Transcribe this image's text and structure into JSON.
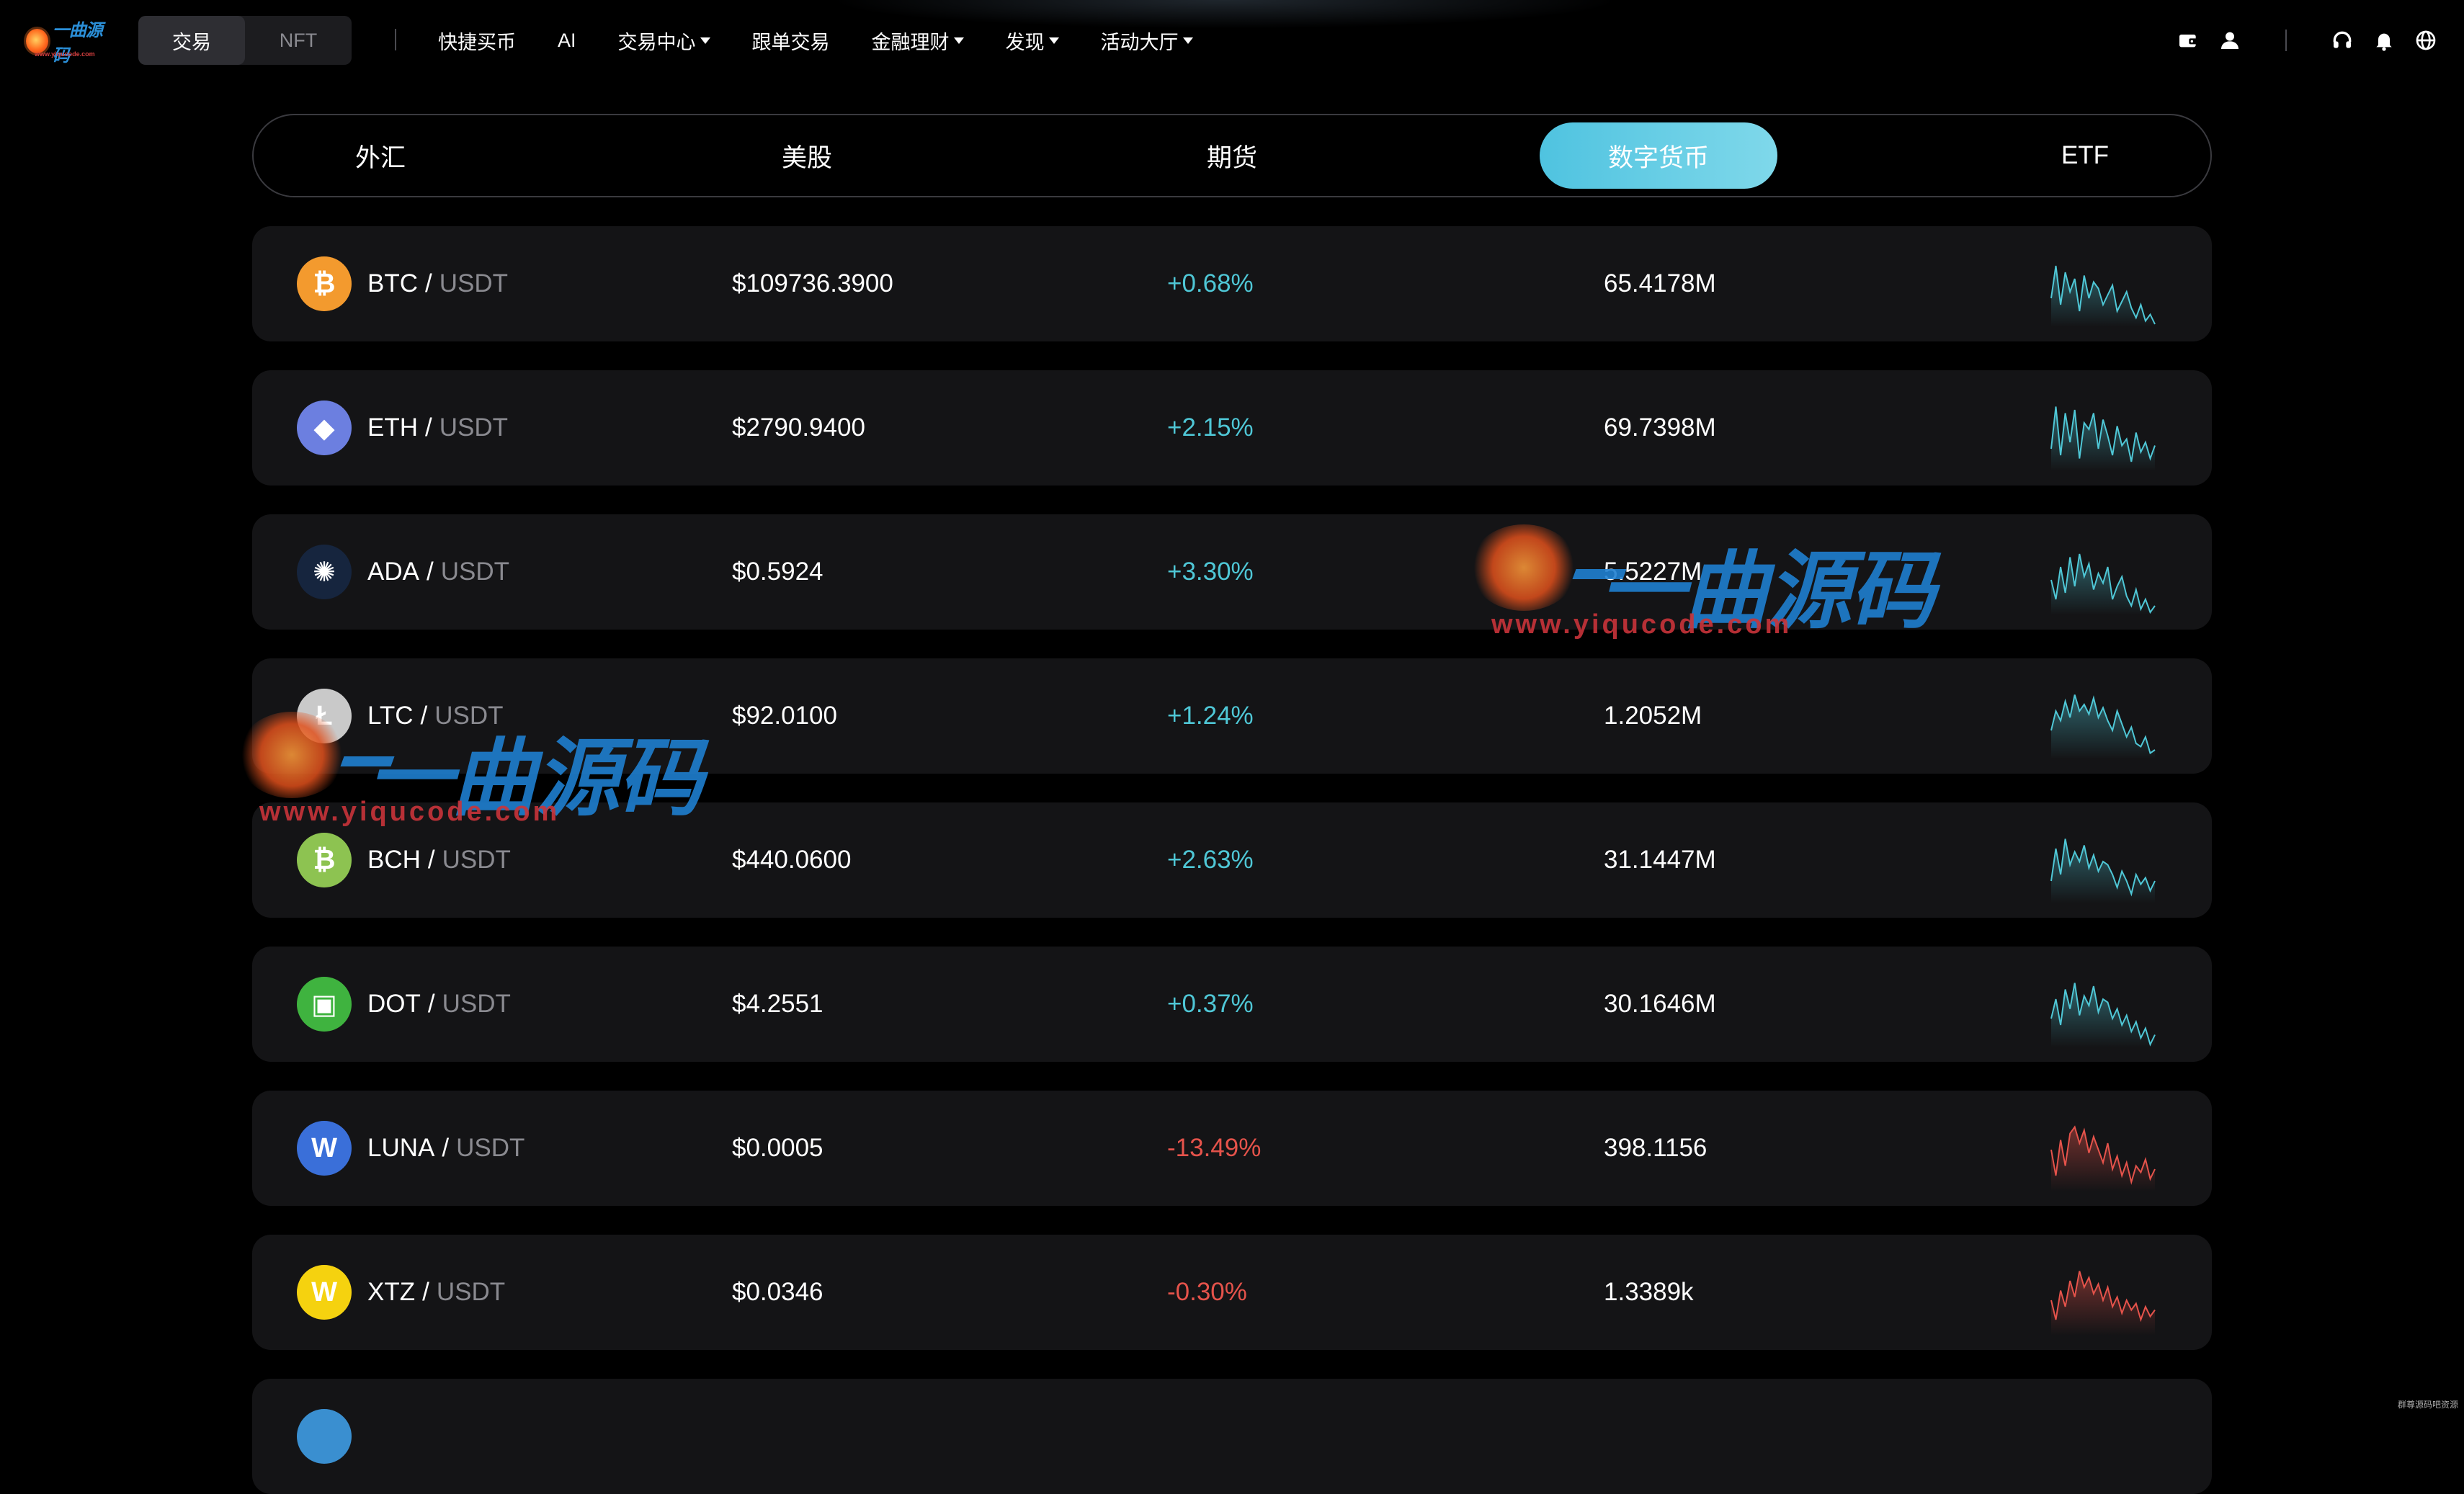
{
  "logo": {
    "text": "一曲源码",
    "url": "www.yiqucode.com"
  },
  "mode_switch": [
    {
      "label": "交易",
      "active": true
    },
    {
      "label": "NFT",
      "active": false
    }
  ],
  "nav": {
    "links": [
      {
        "label": "快捷买币",
        "dropdown": false
      },
      {
        "label": "AI",
        "dropdown": false
      },
      {
        "label": "交易中心",
        "dropdown": true
      },
      {
        "label": "跟单交易",
        "dropdown": false
      },
      {
        "label": "金融理财",
        "dropdown": true
      },
      {
        "label": "发现",
        "dropdown": true
      },
      {
        "label": "活动大厅",
        "dropdown": true
      }
    ],
    "right_icons": [
      "wallet-icon",
      "user-icon",
      "headset-icon",
      "bell-icon",
      "globe-icon"
    ]
  },
  "category_tabs": [
    {
      "label": "外汇",
      "active": false
    },
    {
      "label": "美股",
      "active": false
    },
    {
      "label": "期货",
      "active": false
    },
    {
      "label": "数字货币",
      "active": true
    },
    {
      "label": "ETF",
      "active": false
    }
  ],
  "colors": {
    "up": "#4fc7d6",
    "down": "#e5534b",
    "accent": "#5ccbe4",
    "row_bg": "#141416"
  },
  "markets": [
    {
      "base": "BTC",
      "quote": "USDT",
      "price": "$109736.3900",
      "change": "+0.68%",
      "direction": "up",
      "volume": "65.4178M",
      "icon": "bitcoin-icon",
      "icon_color": "#f39a2e",
      "icon_glyph": "₿",
      "spark": [
        40,
        90,
        30,
        80,
        50,
        70,
        20,
        75,
        40,
        65,
        55,
        30,
        45,
        60,
        20,
        35,
        50,
        25,
        10,
        30,
        5,
        15,
        0
      ]
    },
    {
      "base": "ETH",
      "quote": "USDT",
      "price": "$2790.9400",
      "change": "+2.15%",
      "direction": "up",
      "volume": "69.7398M",
      "icon": "ethereum-icon",
      "icon_color": "#6c7fe0",
      "icon_glyph": "◆",
      "spark": [
        30,
        95,
        20,
        85,
        40,
        90,
        15,
        70,
        60,
        85,
        30,
        75,
        50,
        20,
        65,
        35,
        45,
        10,
        55,
        25,
        40,
        15,
        35
      ]
    },
    {
      "base": "ADA",
      "quote": "USDT",
      "price": "$0.5924",
      "change": "+3.30%",
      "direction": "up",
      "volume": "5.5227M",
      "icon": "cardano-icon",
      "icon_color": "#16253e",
      "icon_glyph": "✺",
      "spark": [
        50,
        20,
        70,
        30,
        85,
        40,
        90,
        55,
        75,
        35,
        60,
        45,
        70,
        20,
        40,
        55,
        25,
        10,
        35,
        5,
        20,
        0,
        10
      ]
    },
    {
      "base": "LTC",
      "quote": "USDT",
      "price": "$92.0100",
      "change": "+1.24%",
      "direction": "up",
      "volume": "1.2052M",
      "icon": "litecoin-icon",
      "icon_color": "#c9c9c9",
      "icon_glyph": "Ł",
      "spark": [
        40,
        70,
        55,
        85,
        60,
        95,
        70,
        80,
        65,
        90,
        60,
        75,
        55,
        40,
        70,
        50,
        30,
        45,
        20,
        15,
        30,
        5,
        10
      ]
    },
    {
      "base": "BCH",
      "quote": "USDT",
      "price": "$440.0600",
      "change": "+2.63%",
      "direction": "up",
      "volume": "31.1447M",
      "icon": "bitcoin-cash-icon",
      "icon_color": "#8dc351",
      "icon_glyph": "₿",
      "spark": [
        30,
        80,
        40,
        95,
        55,
        75,
        60,
        85,
        50,
        70,
        45,
        60,
        55,
        40,
        20,
        45,
        30,
        10,
        40,
        25,
        35,
        15,
        30
      ]
    },
    {
      "base": "DOT",
      "quote": "USDT",
      "price": "$4.2551",
      "change": "+0.37%",
      "direction": "up",
      "volume": "30.1646M",
      "icon": "polkadot-icon",
      "icon_color": "#3fb33f",
      "icon_glyph": "▣",
      "spark": [
        40,
        70,
        30,
        85,
        55,
        95,
        45,
        75,
        60,
        90,
        50,
        70,
        65,
        40,
        55,
        30,
        45,
        20,
        35,
        10,
        25,
        0,
        15
      ]
    },
    {
      "base": "LUNA",
      "quote": "USDT",
      "price": "$0.0005",
      "change": "-13.49%",
      "direction": "down",
      "volume": "398.1156",
      "icon": "terra-icon",
      "icon_color": "#3a6fd9",
      "icon_glyph": "W",
      "spark": [
        60,
        20,
        75,
        35,
        85,
        95,
        70,
        90,
        55,
        80,
        60,
        40,
        70,
        30,
        50,
        20,
        40,
        10,
        35,
        25,
        45,
        15,
        30
      ]
    },
    {
      "base": "XTZ",
      "quote": "USDT",
      "price": "$0.0346",
      "change": "-0.30%",
      "direction": "down",
      "volume": "1.3389k",
      "icon": "tezos-icon",
      "icon_color": "#f5d20f",
      "icon_glyph": "W",
      "spark": [
        50,
        20,
        65,
        40,
        80,
        55,
        95,
        70,
        85,
        60,
        75,
        50,
        70,
        40,
        55,
        30,
        50,
        35,
        45,
        20,
        40,
        25,
        35
      ]
    }
  ],
  "watermark": {
    "title": "一曲源码",
    "url": "www.yiqucode.com"
  },
  "corner_text": "群尊源码吧资源"
}
